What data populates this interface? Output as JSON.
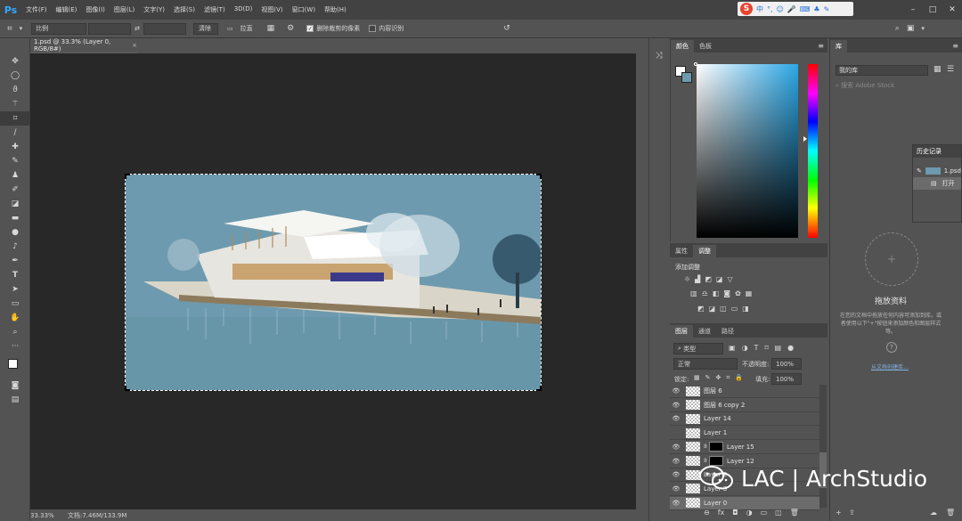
{
  "app": {
    "logo": "Ps"
  },
  "menu": [
    "文件(F)",
    "编辑(E)",
    "图像(I)",
    "图层(L)",
    "文字(Y)",
    "选择(S)",
    "滤镜(T)",
    "3D(D)",
    "视图(V)",
    "窗口(W)",
    "帮助(H)"
  ],
  "ime": {
    "logo": "S",
    "lang": "中"
  },
  "window_controls": {
    "minimize": "–",
    "maximize": "□",
    "close": "✕"
  },
  "options": {
    "ratio_select": "比例",
    "clear_button": "清除",
    "straighten_label": "拉直",
    "delete_cropped_label": "删除裁剪的像素",
    "delete_cropped_checked": true,
    "content_aware_label": "内容识别",
    "content_aware_checked": false
  },
  "document": {
    "tab_title": "1.psd @ 33.3% (Layer 0, RGB/8#)",
    "tab_close": "×"
  },
  "status": {
    "zoom": "33.33%",
    "docinfo": "文档:7.46M/133.9M"
  },
  "color_panel": {
    "tabs": [
      "颜色",
      "色板"
    ],
    "foreground": "#ffffff",
    "background": "#6d9aae"
  },
  "adjust_panel": {
    "tabs": [
      "属性",
      "调整"
    ],
    "title": "添加调整"
  },
  "layers_panel": {
    "tabs": [
      "图层",
      "通道",
      "路径"
    ],
    "filter_kind": "类型",
    "blend_mode": "正常",
    "opacity_label": "不透明度:",
    "opacity_value": "100%",
    "lock_label": "锁定:",
    "fill_label": "填充:",
    "fill_value": "100%",
    "layers": [
      {
        "name": "图层 6",
        "visible": true,
        "has_mask": false
      },
      {
        "name": "图层 6 copy 2",
        "visible": true,
        "has_mask": false
      },
      {
        "name": "Layer 14",
        "visible": true,
        "has_mask": false
      },
      {
        "name": "Layer 1",
        "visible": false,
        "has_mask": false
      },
      {
        "name": "Layer 15",
        "visible": true,
        "has_mask": true
      },
      {
        "name": "Layer 12",
        "visible": true,
        "has_mask": true
      },
      {
        "name": "Layer 2",
        "visible": true,
        "has_mask": false
      },
      {
        "name": "Layer 3",
        "visible": true,
        "has_mask": false
      },
      {
        "name": "Layer 0",
        "visible": true,
        "has_mask": false,
        "selected": true
      }
    ]
  },
  "library_panel": {
    "tab": "库",
    "library_select": "我的库",
    "search_placeholder": "搜索 Adobe Stock",
    "drop_title": "拖放资料",
    "drop_desc": "在您的文档中拖放任何内容可添加到库。或者使用以下\"+\"按钮来添加颜色和图层样式等。",
    "link_text": "从文档创建库..."
  },
  "history_panel": {
    "title": "历史记录",
    "items": [
      "1.psd",
      "打开"
    ]
  },
  "watermark": {
    "text": "LAC | ArchStudio"
  }
}
